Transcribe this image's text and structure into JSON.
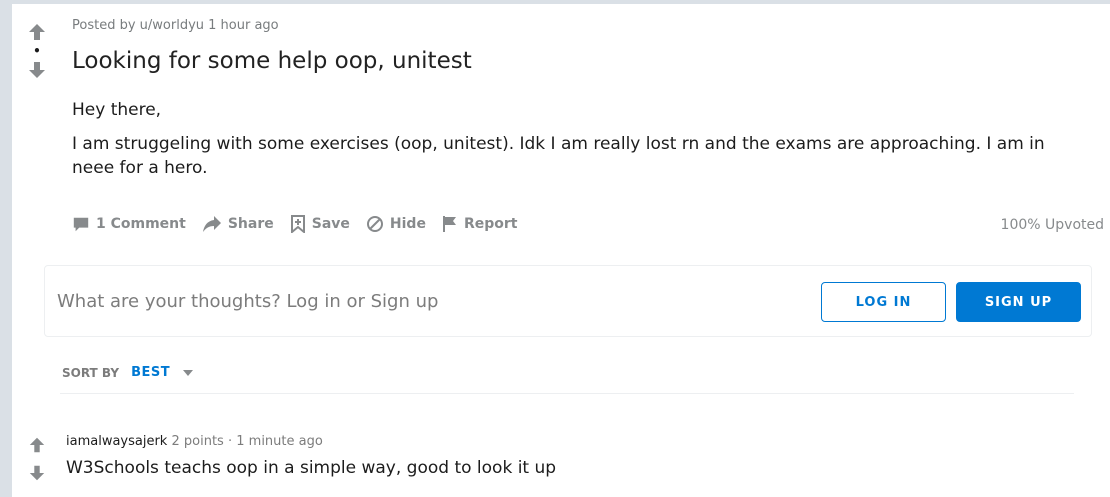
{
  "post": {
    "meta": "Posted by u/worldyu 1 hour ago",
    "score": "•",
    "title": "Looking for some help oop, unitest",
    "body": [
      "Hey there,",
      "I am struggeling with some exercises (oop, unitest). Idk I am really lost rn and the exams are approaching. I am in neee for a hero."
    ],
    "actions": {
      "comments": "1 Comment",
      "share": "Share",
      "save": "Save",
      "hide": "Hide",
      "report": "Report"
    },
    "upvoted": "100% Upvoted"
  },
  "comment_box": {
    "prompt": "What are your thoughts? Log in or Sign up",
    "login_label": "LOG IN",
    "signup_label": "SIGN UP"
  },
  "sort": {
    "label": "SORT BY",
    "value": "BEST"
  },
  "comments": [
    {
      "author": "iamalwaysajerk",
      "points": "2 points",
      "separator": "·",
      "time": "1 minute ago",
      "body": "W3Schools teachs oop in a simple way, good to look it up"
    }
  ],
  "colors": {
    "accent": "#0079d3",
    "muted": "#878a8c",
    "background": "#dae0e6"
  }
}
